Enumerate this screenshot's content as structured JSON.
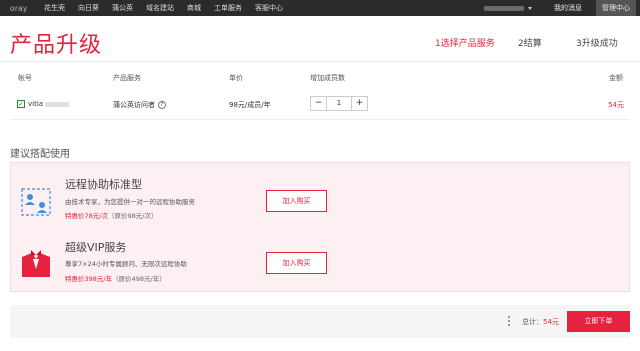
{
  "topbar": {
    "logo": "oray",
    "nav": [
      "花生壳",
      "向日葵",
      "蒲公英",
      "域名建站",
      "商城",
      "工单服务",
      "客服中心"
    ],
    "messages": "我的消息",
    "admin": "管理中心"
  },
  "header": {
    "title": "产品升级",
    "steps": [
      "1选择产品服务",
      "2结算",
      "3升级成功"
    ]
  },
  "table": {
    "headers": [
      "帐号",
      "产品服务",
      "单价",
      "增加成员数",
      "金额"
    ],
    "row": {
      "account": "vitia",
      "service": "蒲公英访问者",
      "price": "98元/成员/年",
      "qty": "1",
      "minus": "−",
      "plus": "+",
      "amount": "54元"
    }
  },
  "recommend": {
    "title": "建议搭配使用",
    "items": [
      {
        "name": "远程协助标准型",
        "desc": "由技术专家，为您提供一对一的远程协助服务",
        "deal": "特惠价78元/次",
        "orig": "（原价98元/次）",
        "button": "加入购买"
      },
      {
        "name": "超级VIP服务",
        "desc": "尊享7×24小时专属顾问、无限次远程协助",
        "deal": "特惠价398元/年",
        "orig": "（原价498元/年）",
        "button": "加入购买"
      }
    ]
  },
  "footer": {
    "total_label": "总计：",
    "total_value": "54元",
    "order_button": "立即下单"
  },
  "colors": {
    "accent": "#e6223f",
    "topbar": "#2b2b2b",
    "pink_bg": "#fdf0f3"
  }
}
